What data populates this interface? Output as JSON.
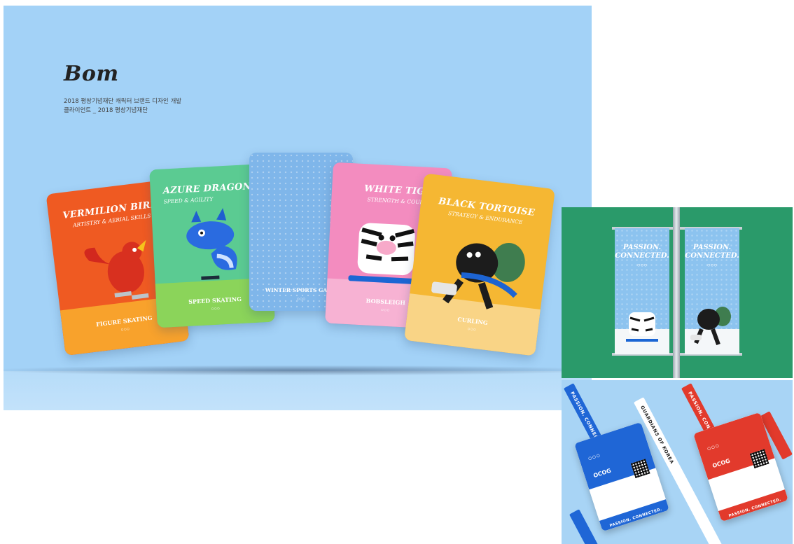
{
  "hero": {
    "logo": "Bom",
    "subtitle_line1": "2018 평창기념재단 캐릭터 브랜드 디자인 개발",
    "subtitle_line2": "클라이언트 _ 2018 평창기념재단"
  },
  "cards": [
    {
      "title": "VERMILION BIRD",
      "sub": "ARTISTRY & AERIAL SKILLS",
      "footer": "FIGURE SKATING"
    },
    {
      "title": "AZURE DRAGON",
      "sub": "SPEED & AGILITY",
      "footer": "SPEED SKATING"
    },
    {
      "title": "",
      "sub": "",
      "footer": "WINTER SPORTS GAME"
    },
    {
      "title": "WHITE TIGER",
      "sub": "STRENGTH & COURAGE",
      "footer": "BOBSLEIGH"
    },
    {
      "title": "BLACK TORTOISE",
      "sub": "STRATEGY & ENDURANCE",
      "footer": "CURLING"
    }
  ],
  "banners": {
    "left_text_line1": "PASSION.",
    "left_text_line2": "CONNECTED.",
    "right_text_line1": "PASSION.",
    "right_text_line2": "CONNECTED."
  },
  "lanyards": {
    "strap_text_1": "PASSION. CONNECTED.",
    "strap_text_2": "GUARDIANS OF KOREA",
    "strap_text_3": "PASSION. CONNECTED.",
    "card_left_label": "OCOG",
    "card_right_label": "OCOG",
    "card_footer": "PASSION. CONNECTED."
  },
  "colors": {
    "hero_bg": "#a3d2f7",
    "vermilion": "#ef5a22",
    "azure": "#5bcb92",
    "center_card": "#7fb6ea",
    "white_tiger": "#f38cbf",
    "black_tortoise": "#f5b733",
    "banner_bg": "#2a9a6a",
    "lanyard_blue": "#1f66d6",
    "lanyard_red": "#e23a2c"
  }
}
